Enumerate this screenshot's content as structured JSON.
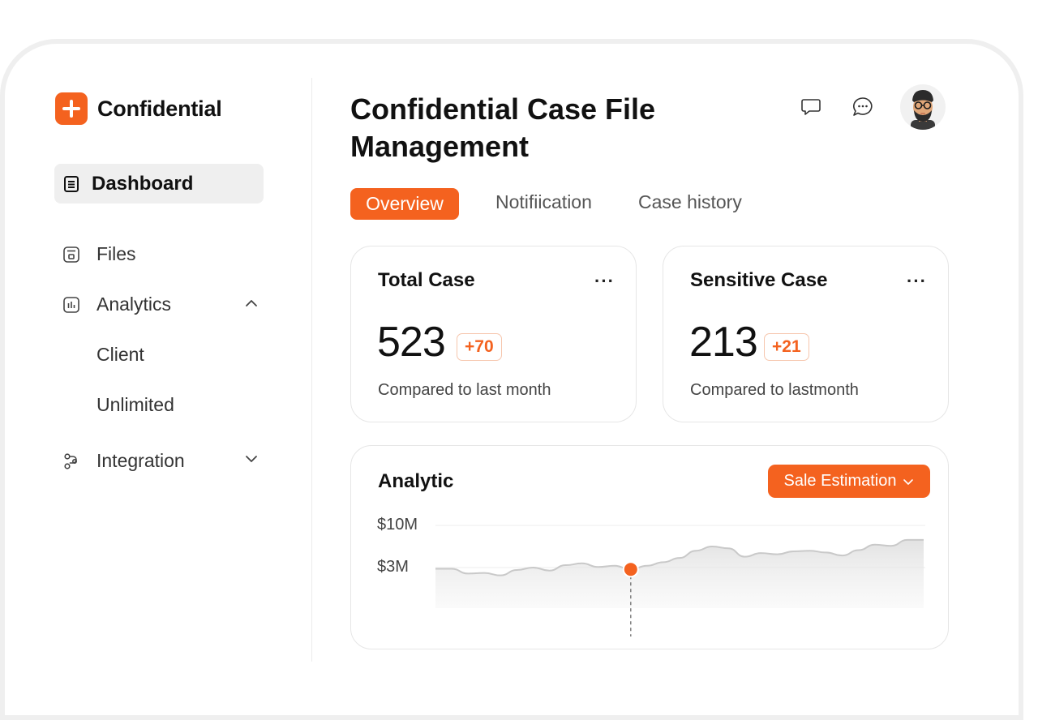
{
  "brand": {
    "name": "Confidential",
    "accent": "#f4621f"
  },
  "sidebar": {
    "active": {
      "label": "Dashboard",
      "icon": "document-icon"
    },
    "items": [
      {
        "label": "Files",
        "icon": "file-icon"
      },
      {
        "label": "Analytics",
        "icon": "bar-chart-icon",
        "expanded": true,
        "children": [
          "Client",
          "Unlimited"
        ]
      },
      {
        "label": "Integration",
        "icon": "integration-icon",
        "expanded": false
      }
    ]
  },
  "header": {
    "title": "Confidential Case File Management",
    "icons": [
      "chat-bubble-icon",
      "message-dots-icon",
      "avatar"
    ]
  },
  "tabs": [
    {
      "label": "Overview",
      "active": true
    },
    {
      "label": "Notifiication",
      "active": false
    },
    {
      "label": "Case history",
      "active": false
    }
  ],
  "cards": [
    {
      "title": "Total Case",
      "value": "523",
      "badge": "+70",
      "subtitle": "Compared to last month",
      "more": "···"
    },
    {
      "title": "Sensitive Case",
      "value": "213",
      "badge": "+21",
      "subtitle": "Compared to lastmonth",
      "more": "···"
    }
  ],
  "analytic": {
    "title": "Analytic",
    "dropdown_label": "Sale Estimation",
    "y_ticks": [
      "$10M",
      "$3M"
    ]
  },
  "chart_data": {
    "type": "area",
    "yticks": [
      "$10M",
      "$3M"
    ],
    "series": [
      {
        "values": [
          2.8,
          2.8,
          2.0,
          2.1,
          1.7,
          2.6,
          3.0,
          2.5,
          3.4,
          3.7,
          3.1,
          3.3,
          2.7,
          3.3,
          3.9,
          4.6,
          5.8,
          6.5,
          6.2,
          4.8,
          5.4,
          5.2,
          5.7,
          5.8,
          5.5,
          5.0,
          5.9,
          6.8,
          6.6,
          7.6,
          7.6
        ]
      }
    ],
    "highlight_index": 12,
    "highlight_color": "#f4621f"
  }
}
